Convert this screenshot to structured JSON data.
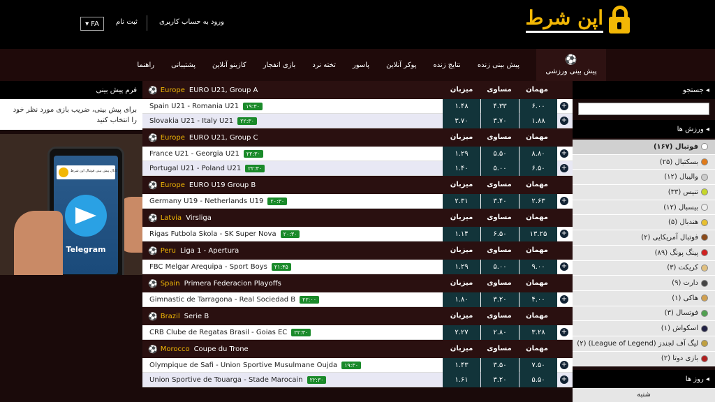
{
  "header": {
    "logo_text": "اپن شرط",
    "login": "ورود به حساب کاربری",
    "signup": "ثبت نام",
    "lang": "FA"
  },
  "nav": {
    "active": "پیش بینی ورزشی",
    "items": [
      "پیش بینی زنده",
      "نتایج زنده",
      "پوکر آنلاین",
      "پاسور",
      "تخته نرد",
      "بازی انفجار",
      "کازینو آنلاین",
      "پشتیبانی",
      "راهنما"
    ]
  },
  "left": {
    "title": "فرم پیش بینی",
    "desc": "برای پیش بینی، ضریب بازی مورد نظر خود را انتخاب کنید",
    "promo_banner": "کانال پیش بینی فوتبال اپن شرط",
    "promo_label": "Telegram"
  },
  "columns": {
    "guest": "مهمان",
    "draw": "مساوی",
    "host": "میزبان"
  },
  "leagues": [
    {
      "region": "Europe",
      "name": "EURO U21, Group A",
      "matches": [
        {
          "teams": "Spain U21  -  Romania U21",
          "time": "۱۹:۳۰",
          "h": "۱.۴۸",
          "d": "۴.۳۳",
          "a": "۶.۰۰"
        },
        {
          "teams": "Slovakia U21  -  Italy U21",
          "time": "۲۲:۳۰",
          "h": "۳.۷۰",
          "d": "۳.۷۰",
          "a": "۱.۸۸"
        }
      ]
    },
    {
      "region": "Europe",
      "name": "EURO U21, Group C",
      "matches": [
        {
          "teams": "France U21  -  Georgia U21",
          "time": "۲۲:۳۰",
          "h": "۱.۲۹",
          "d": "۵.۵۰",
          "a": "۸.۸۰"
        },
        {
          "teams": "Portugal U21  -  Poland U21",
          "time": "۲۲:۳۰",
          "h": "۱.۴۰",
          "d": "۵.۰۰",
          "a": "۶.۵۰"
        }
      ]
    },
    {
      "region": "Europe",
      "name": "EURO U19 Group B",
      "matches": [
        {
          "teams": "Germany U19  -  Netherlands U19",
          "time": "۲۰:۳۰",
          "h": "۲.۳۱",
          "d": "۳.۴۰",
          "a": "۲.۶۳"
        }
      ]
    },
    {
      "region": "Latvia",
      "name": "Virsliga",
      "matches": [
        {
          "teams": "Rigas Futbola Skola  -  SK Super Nova",
          "time": "۲۰:۳۰",
          "h": "۱.۱۴",
          "d": "۶.۵۰",
          "a": "۱۳.۲۵"
        }
      ]
    },
    {
      "region": "Peru",
      "name": "Liga 1 - Apertura",
      "matches": [
        {
          "teams": "FBC Melgar Arequipa  -  Sport Boys",
          "time": "۲۱:۴۵",
          "h": "۱.۲۹",
          "d": "۵.۰۰",
          "a": "۹.۰۰"
        }
      ]
    },
    {
      "region": "Spain",
      "name": "Primera Federacion Playoffs",
      "matches": [
        {
          "teams": "Gimnastic de Tarragona  -  Real Sociedad B",
          "time": "۲۲:۰۰",
          "h": "۱.۸۰",
          "d": "۳.۲۰",
          "a": "۴.۰۰"
        }
      ]
    },
    {
      "region": "Brazil",
      "name": "Serie B",
      "matches": [
        {
          "teams": "CRB Clube de Regatas Brasil  -  Goias EC",
          "time": "۲۲:۳۰",
          "h": "۲.۲۷",
          "d": "۲.۸۰",
          "a": "۳.۲۸"
        }
      ]
    },
    {
      "region": "Morocco",
      "name": "Coupe du Trone",
      "matches": [
        {
          "teams": "Olympique de Safi  -  Union Sportive Musulmane Oujda",
          "time": "۱۹:۳۰",
          "h": "۱.۴۳",
          "d": "۳.۵۰",
          "a": "۷.۵۰"
        },
        {
          "teams": "Union Sportive de Touarga  -  Stade Marocain",
          "time": "۲۲:۳۰",
          "h": "۱.۶۱",
          "d": "۳.۲۰",
          "a": "۵.۵۰"
        }
      ]
    }
  ],
  "right": {
    "search_title": "جستجو",
    "sports_title": "ورزش ها",
    "sports": [
      {
        "label": "فوتبال (۱۶۷)",
        "color": "#ffffff"
      },
      {
        "label": "بسکتبال (۲۵)",
        "color": "#e07a1a"
      },
      {
        "label": "والیبال (۱۲)",
        "color": "#cccccc"
      },
      {
        "label": "تنیس (۳۳)",
        "color": "#c6d62a"
      },
      {
        "label": "بیسبال (۱۲)",
        "color": "#eeeeee"
      },
      {
        "label": "هندبال (۵)",
        "color": "#e8c030"
      },
      {
        "label": "فوتبال آمریکایی (۲)",
        "color": "#8a4a1a"
      },
      {
        "label": "پینگ پونگ (۸۹)",
        "color": "#d02020"
      },
      {
        "label": "کریکت (۳)",
        "color": "#e0c080"
      },
      {
        "label": "دارت (۹)",
        "color": "#444444"
      },
      {
        "label": "هاکی (۱)",
        "color": "#d0a050"
      },
      {
        "label": "فوتسال (۳)",
        "color": "#50a050"
      },
      {
        "label": "اسکواش (۱)",
        "color": "#222244"
      },
      {
        "label": "لیگ آف لجندز (League of Legend) (۲)",
        "color": "#c0a040"
      },
      {
        "label": "بازی دوتا (۲)",
        "color": "#b02020"
      }
    ],
    "days_title": "روز ها",
    "day": "شنبه"
  }
}
